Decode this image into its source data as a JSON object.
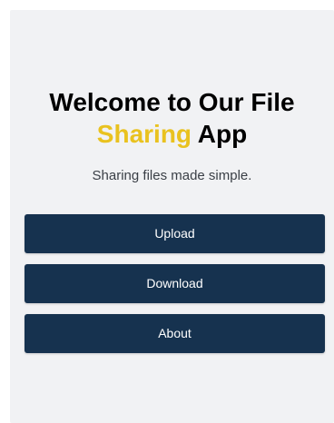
{
  "header": {
    "title_line1": "Welcome to Our File",
    "title_accent": "Sharing",
    "title_end": " App",
    "subtitle": "Sharing files made simple."
  },
  "buttons": {
    "upload": "Upload",
    "download": "Download",
    "about": "About"
  },
  "colors": {
    "accent": "#e9c21f",
    "button_bg": "#16324f",
    "card_bg": "#f1f2f4"
  }
}
